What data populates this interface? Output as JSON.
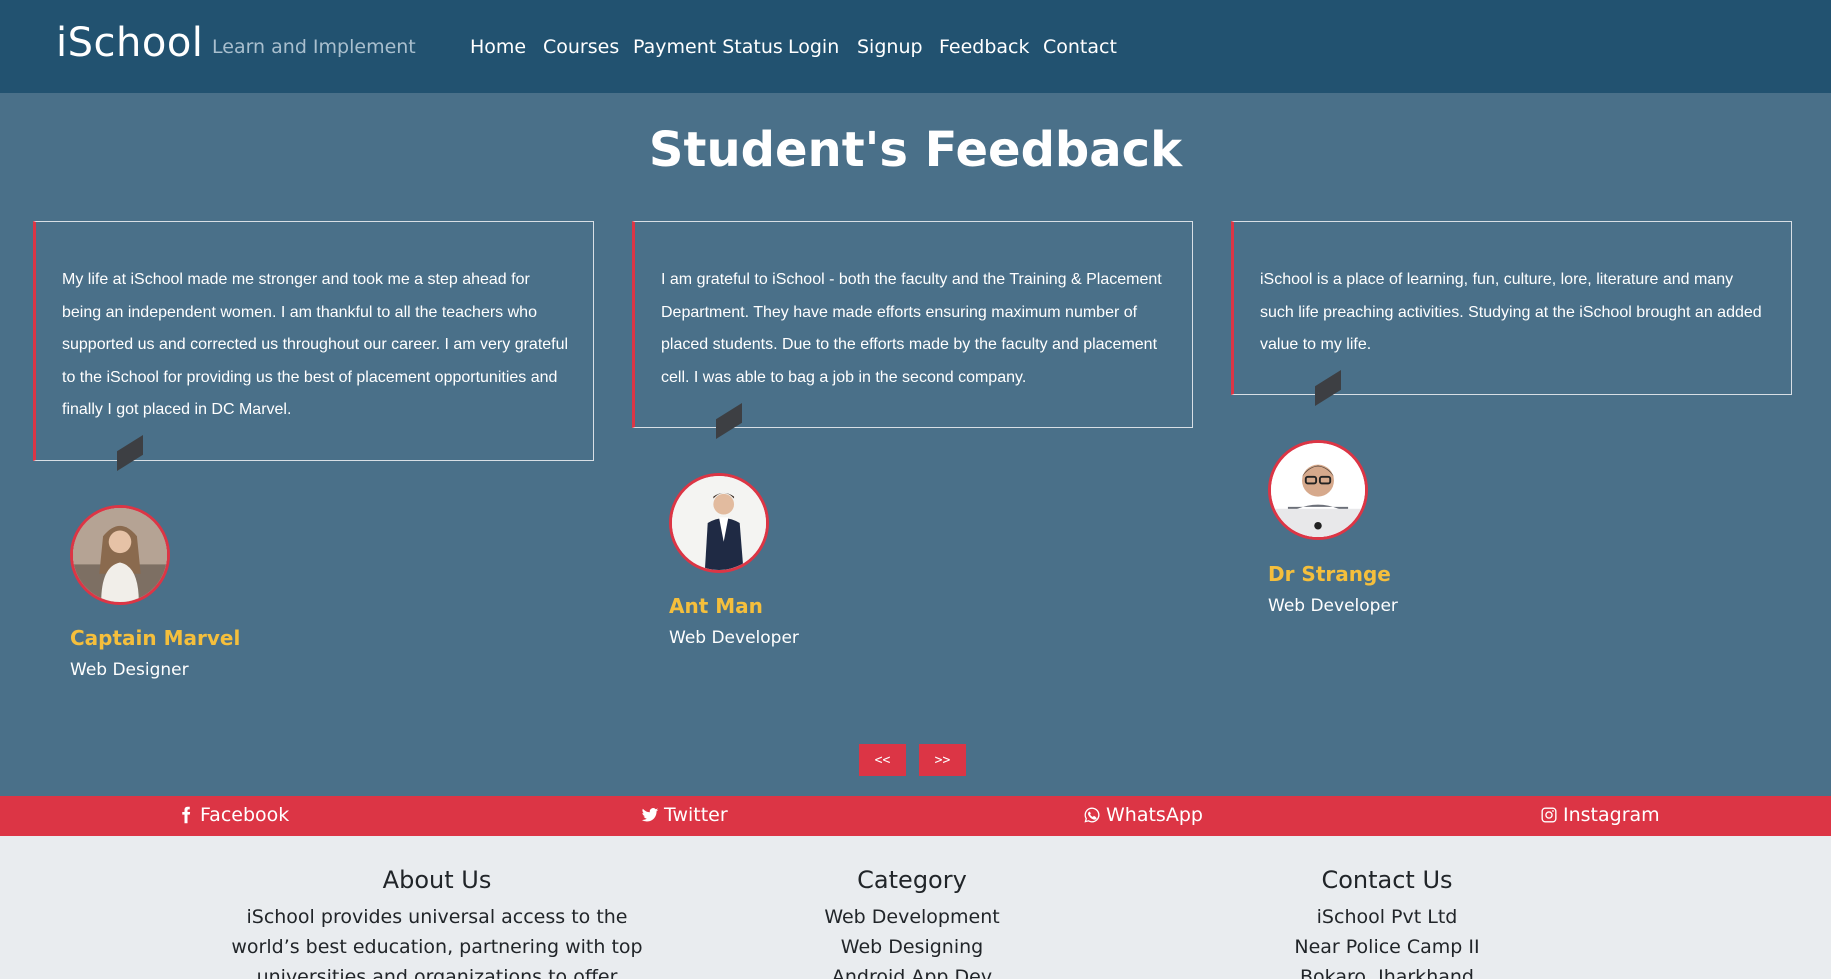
{
  "navbar": {
    "brand": "iSchool",
    "tagline": "Learn and Implement",
    "links": [
      "Home",
      "Courses",
      "Payment Status",
      "Login",
      "Signup",
      "Feedback",
      "Contact"
    ]
  },
  "page_title": "Student's Feedback",
  "testimonials": [
    {
      "text": "My life at iSchool made me stronger and took me a step ahead for being an independent women. I am thankful to all the teachers who supported us and corrected us throughout our career. I am very grateful to the iSchool for providing us the best of placement opportunities and finally I got placed in DC Marvel.",
      "name": "Captain Marvel",
      "role": "Web Designer"
    },
    {
      "text": "I am grateful to iSchool - both the faculty and the Training & Placement Department. They have made efforts ensuring maximum number of placed students. Due to the efforts made by the faculty and placement cell. I was able to bag a job in the second company.",
      "name": "Ant Man",
      "role": "Web Developer"
    },
    {
      "text": "iSchool is a place of learning, fun, culture, lore, literature and many such life preaching activities. Studying at the iSchool brought an added value to my life.",
      "name": "Dr Strange",
      "role": "Web Developer"
    }
  ],
  "carousel": {
    "prev": "<<",
    "next": ">>"
  },
  "social": {
    "facebook": "Facebook",
    "twitter": "Twitter",
    "whatsapp": "WhatsApp",
    "instagram": "Instagram"
  },
  "footer": {
    "about": {
      "title": "About Us",
      "text": "iSchool provides universal access to the world’s best education, partnering with top universities and organizations to offer courses online."
    },
    "category": {
      "title": "Category",
      "items": [
        "Web Development",
        "Web Designing",
        "Android App Dev"
      ]
    },
    "contact": {
      "title": "Contact Us",
      "lines": [
        "iSchool Pvt Ltd",
        "Near Police Camp II",
        "Bokaro, Jharkhand"
      ]
    }
  },
  "colors": {
    "navbar": "#225270",
    "section_bg": "#4a7089",
    "accent_red": "#dc3545",
    "name_yellow": "#f5bf3c",
    "footer_bg": "#e9ecef"
  }
}
